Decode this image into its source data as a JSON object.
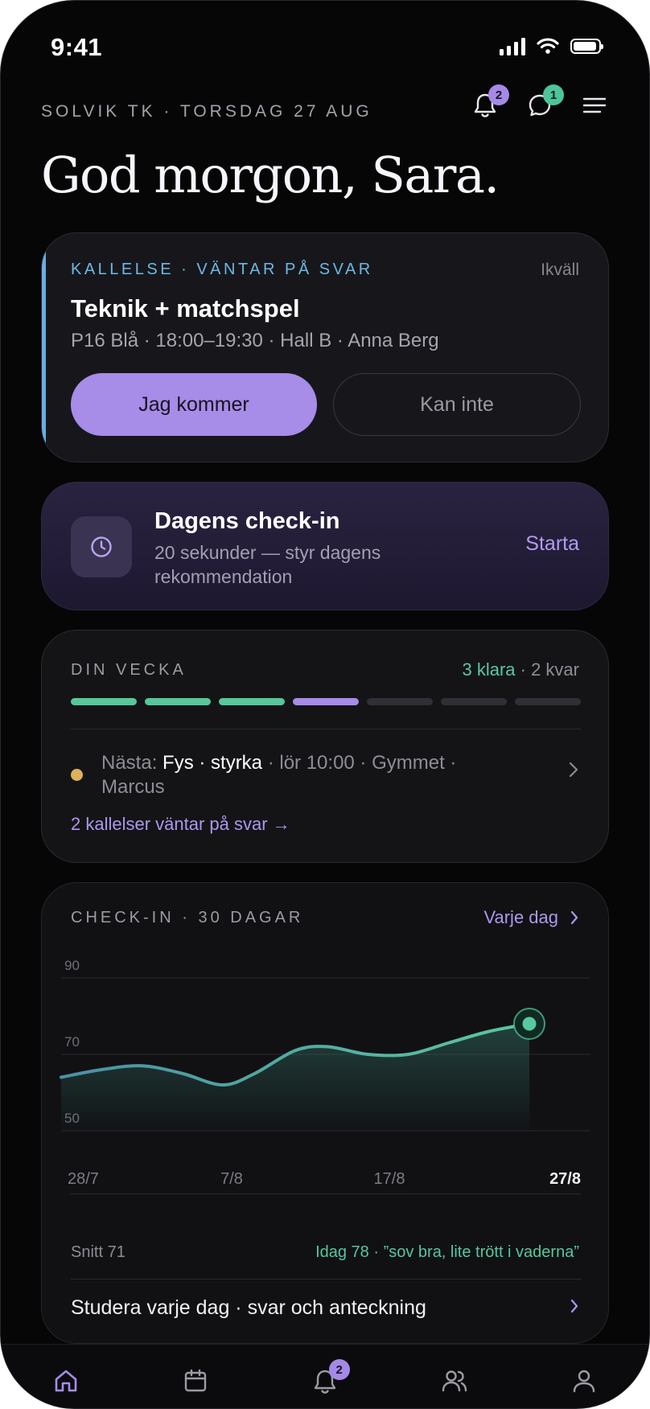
{
  "status_bar": {
    "time": "9:41"
  },
  "header": {
    "club_line": "SOLVIK TK · TORSDAG 27 AUG",
    "notification_count": "2",
    "message_count": "1",
    "greeting": "God morgon, Sara."
  },
  "invite_card": {
    "tag": "KALLELSE · VÄNTAR PÅ SVAR",
    "when": "Ikväll",
    "title": "Teknik + matchspel",
    "details": "P16 Blå · 18:00–19:30 · Hall B · Anna Berg",
    "accept_label": "Jag kommer",
    "decline_label": "Kan inte"
  },
  "checkin_card": {
    "title": "Dagens check-in",
    "subtitle": "20 sekunder — styr dagens rekommendation",
    "action": "Starta"
  },
  "week_card": {
    "label": "DIN VECKA",
    "done_text": "3 klara",
    "remaining_text": " · 2 kvar",
    "segments": [
      "done",
      "done",
      "done",
      "current",
      "todo",
      "todo",
      "todo"
    ],
    "next_prefix": "Nästa: ",
    "next_session": "Fys · styrka",
    "next_details": " · lör 10:00 · Gymmet · Marcus",
    "pending_link": "2 kallelser väntar på svar →"
  },
  "chart_card": {
    "label": "CHECK-IN · 30 DAGAR",
    "link": "Varje dag",
    "summary_left": "Snitt 71",
    "summary_right": "Idag 78 · ”sov bra, lite trött i vaderna”",
    "study_link": "Studera varje dag · svar och anteckning"
  },
  "chart_data": {
    "type": "area",
    "x": [
      0,
      5,
      10,
      15,
      20,
      24,
      29,
      33,
      38,
      43,
      48,
      53,
      58
    ],
    "values": [
      64,
      66,
      67,
      65,
      62,
      65,
      71,
      72,
      70,
      70,
      73,
      76,
      78
    ],
    "y_ticks": [
      90,
      70,
      50
    ],
    "ylim": [
      50,
      90
    ],
    "x_tick_labels": [
      "28/7",
      "7/8",
      "17/8",
      "27/8"
    ],
    "x_ticks_at": [
      0,
      10,
      20,
      30
    ],
    "line_color": "#4fae9b",
    "highlight_color": "#58c99e",
    "grid": true
  },
  "tab_bar": {
    "items": [
      "home-icon",
      "calendar-icon",
      "bell-icon",
      "team-icon",
      "profile-icon"
    ],
    "bell_badge": "2"
  },
  "colors": {
    "accent_purple": "#a78ce8",
    "accent_green": "#57c69b",
    "accent_blue": "#6aaee0",
    "accent_yellow": "#dcb25a"
  }
}
